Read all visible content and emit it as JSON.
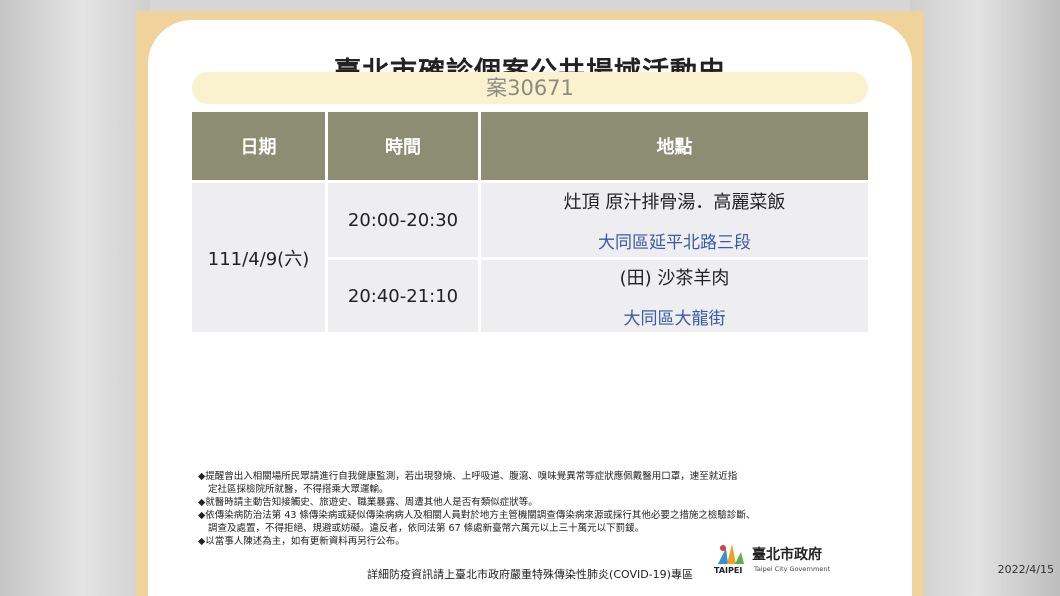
{
  "title": "臺北市確診個案公共場域活動史",
  "case": "案30671",
  "table": {
    "headers": {
      "date": "日期",
      "time": "時間",
      "location": "地點"
    },
    "date": "111/4/9(六)",
    "rows": [
      {
        "time": "20:00-20:30",
        "name": "灶頂 原汁排骨湯．高麗菜飯",
        "address": "大同區延平北路三段"
      },
      {
        "time": "20:40-21:10",
        "name": "(田) 沙茶羊肉",
        "address": "大同區大龍街"
      }
    ]
  },
  "notes": {
    "n1a": "◆提醒曾出入相關場所民眾請進行自我健康監測，若出現發燒、上呼吸道、腹瀉、嗅味覺異常等症狀應佩戴醫用口罩，速至就近指",
    "n1b": "定社區採檢院所就醫，不得搭乘大眾運輸。",
    "n2": "◆就醫時請主動告知接觸史、旅遊史、職業暴露、周遭其他人是否有類似症狀等。",
    "n3a": "◆依傳染病防治法第 43 條傳染病或疑似傳染病病人及相關人員對於地方主管機關調查傳染病來源或採行其他必要之措施之檢驗診斷、",
    "n3b": "調查及處置，不得拒絕、規避或妨礙。違反者，依同法第 67 條處新臺幣六萬元以上三十萬元以下罰鍰。",
    "n4": "◆以當事人陳述為主，如有更新資料再另行公布。"
  },
  "footer": "詳細防疫資訊請上臺北市政府嚴重特殊傳染性肺炎(COVID-19)專區",
  "logo": {
    "cn": "臺北市政府",
    "en1": "TAIPEI",
    "en2": "Taipei City Government"
  },
  "date_stamp": "2022/4/15"
}
